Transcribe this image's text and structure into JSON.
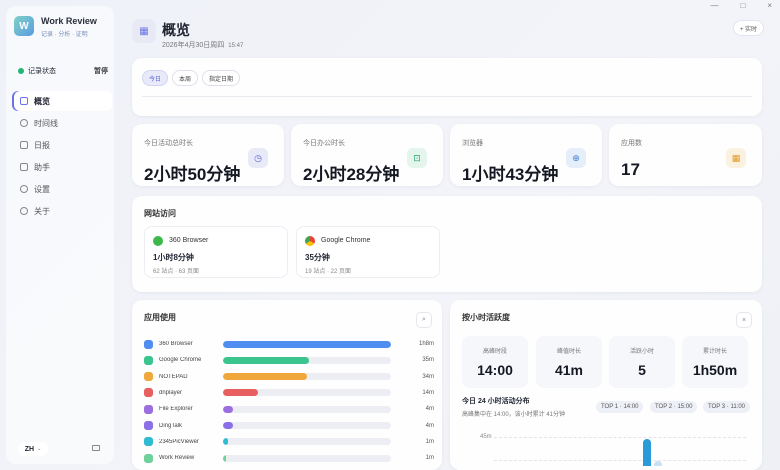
{
  "window": {
    "minimize": "—",
    "maximize": "□",
    "close": "×"
  },
  "brand": {
    "name": "Work Review",
    "subtitle": "记录 · 分析 · 证明",
    "logo_letter": "W"
  },
  "status": {
    "label": "记录状态",
    "pause": "暂停",
    "color": "#22b573"
  },
  "nav": [
    {
      "label": "概览",
      "active": true
    },
    {
      "label": "时间线"
    },
    {
      "label": "日报"
    },
    {
      "label": "助手"
    },
    {
      "label": "设置"
    },
    {
      "label": "关于"
    }
  ],
  "language": "ZH",
  "header": {
    "title": "概览",
    "date": "2026年4月30日周四",
    "time": "15:47",
    "realtime": "+ 实时"
  },
  "filters": [
    "今日",
    "本周",
    "指定日期"
  ],
  "stats": [
    {
      "label": "今日活动总时长",
      "value": "2小时50分钟"
    },
    {
      "label": "今日办公时长",
      "value": "2小时28分钟"
    },
    {
      "label": "浏览器",
      "value": "1小时43分钟"
    },
    {
      "label": "应用数",
      "value": "17"
    }
  ],
  "sites": {
    "title": "网站访问",
    "items": [
      {
        "name": "360 Browser",
        "time": "1小时8分钟",
        "meta": "62 站点 · 63 页面"
      },
      {
        "name": "Google Chrome",
        "time": "35分钟",
        "meta": "19 站点 · 22 页面"
      }
    ]
  },
  "apps": {
    "title": "应用使用",
    "items": [
      {
        "name": "360 Browser",
        "time": "1h8m",
        "fraction": 1.0,
        "color": "#4f8ef0"
      },
      {
        "name": "Google Chrome",
        "time": "35m",
        "fraction": 0.51,
        "color": "#3cc48f"
      },
      {
        "name": "NOTEPAD",
        "time": "34m",
        "fraction": 0.5,
        "color": "#f0a83c"
      },
      {
        "name": "dnplayer",
        "time": "14m",
        "fraction": 0.21,
        "color": "#e85f5f"
      },
      {
        "name": "File Explorer",
        "time": "4m",
        "fraction": 0.06,
        "color": "#9b6fe0"
      },
      {
        "name": "DingTalk",
        "time": "4m",
        "fraction": 0.06,
        "color": "#8a6fe6"
      },
      {
        "name": "2345PicViewer",
        "time": "1m",
        "fraction": 0.03,
        "color": "#30bcd0"
      },
      {
        "name": "Work Review",
        "time": "1m",
        "fraction": 0.02,
        "color": "#6ed09a"
      }
    ]
  },
  "hourly": {
    "title": "按小时活跃度",
    "metrics": [
      {
        "label": "高峰时段",
        "value": "14:00"
      },
      {
        "label": "峰值时长",
        "value": "41m"
      },
      {
        "label": "活跃小时",
        "value": "5"
      },
      {
        "label": "累计时长",
        "value": "1h50m"
      }
    ],
    "dist_title": "今日 24 小时活动分布",
    "dist_sub": "高峰集中在 14:00，该小时累计 41分钟",
    "top": [
      "TOP 1 · 14:00",
      "TOP 2 · 15:00",
      "TOP 3 · 11:00"
    ],
    "axis_label": "45m",
    "bars": [
      {
        "hour": 14,
        "minutes": 41,
        "color": "#2a9ad8"
      },
      {
        "hour": 15,
        "minutes": 8,
        "color": "#c8e0f2"
      }
    ]
  }
}
